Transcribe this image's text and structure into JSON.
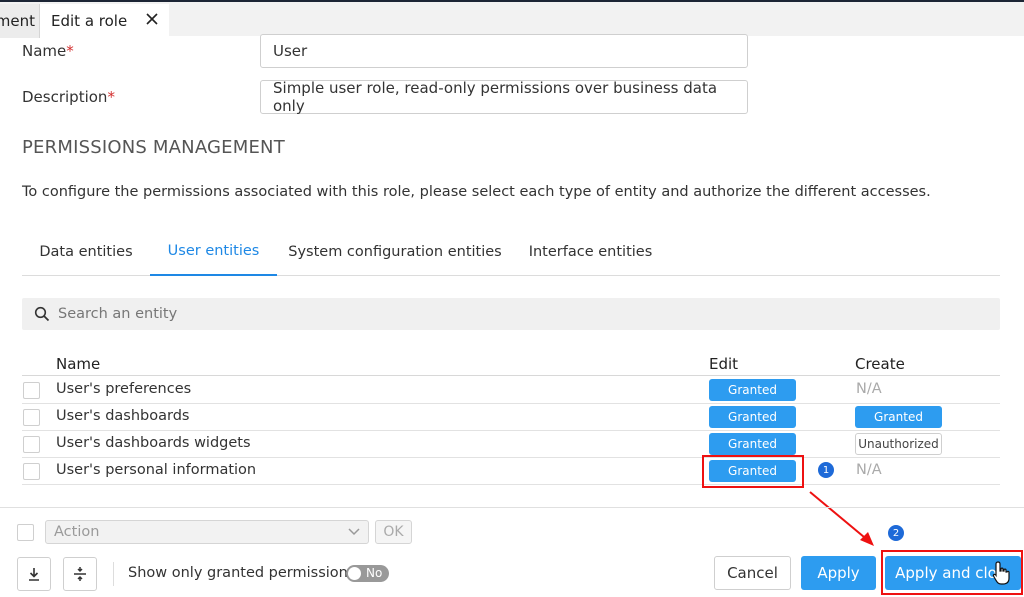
{
  "tabs": {
    "previous": "ment",
    "active": "Edit a role"
  },
  "form": {
    "name_label": "Name",
    "name_value": "User",
    "description_label": "Description",
    "description_value": "Simple user role, read-only permissions over business data only",
    "required_marker": "*"
  },
  "permissions": {
    "title": "PERMISSIONS MANAGEMENT",
    "description": "To configure the permissions associated with this role, please select each type of entity and authorize the different accesses.",
    "entity_tabs": [
      "Data entities",
      "User entities",
      "System configuration entities",
      "Interface entities"
    ],
    "active_tab": "User entities",
    "search_placeholder": "Search an entity",
    "columns": {
      "name": "Name",
      "edit": "Edit",
      "create": "Create"
    },
    "rows": [
      {
        "name": "User's preferences",
        "edit": "Granted",
        "create": "N/A"
      },
      {
        "name": "User's dashboards",
        "edit": "Granted",
        "create": "Granted"
      },
      {
        "name": "User's dashboards widgets",
        "edit": "Granted",
        "create": "Unauthorized"
      },
      {
        "name": "User's personal information",
        "edit": "Granted",
        "create": "N/A"
      }
    ]
  },
  "footer": {
    "action_placeholder": "Action",
    "ok_label": "OK",
    "show_granted_label": "Show only granted permissions",
    "toggle_label": "No",
    "cancel_label": "Cancel",
    "apply_label": "Apply",
    "apply_close_label": "Apply and clo"
  },
  "annotations": {
    "step1": "1",
    "step2": "2"
  },
  "icons": [
    "close-icon",
    "search-icon",
    "chevron-down-icon",
    "download-icon",
    "expand-vertical-icon",
    "hand-cursor-icon"
  ],
  "colors": {
    "accent": "#2d9cf0",
    "highlight": "#e11111",
    "step_badge": "#1e6ad8",
    "topbar_border": "#1c2535"
  }
}
